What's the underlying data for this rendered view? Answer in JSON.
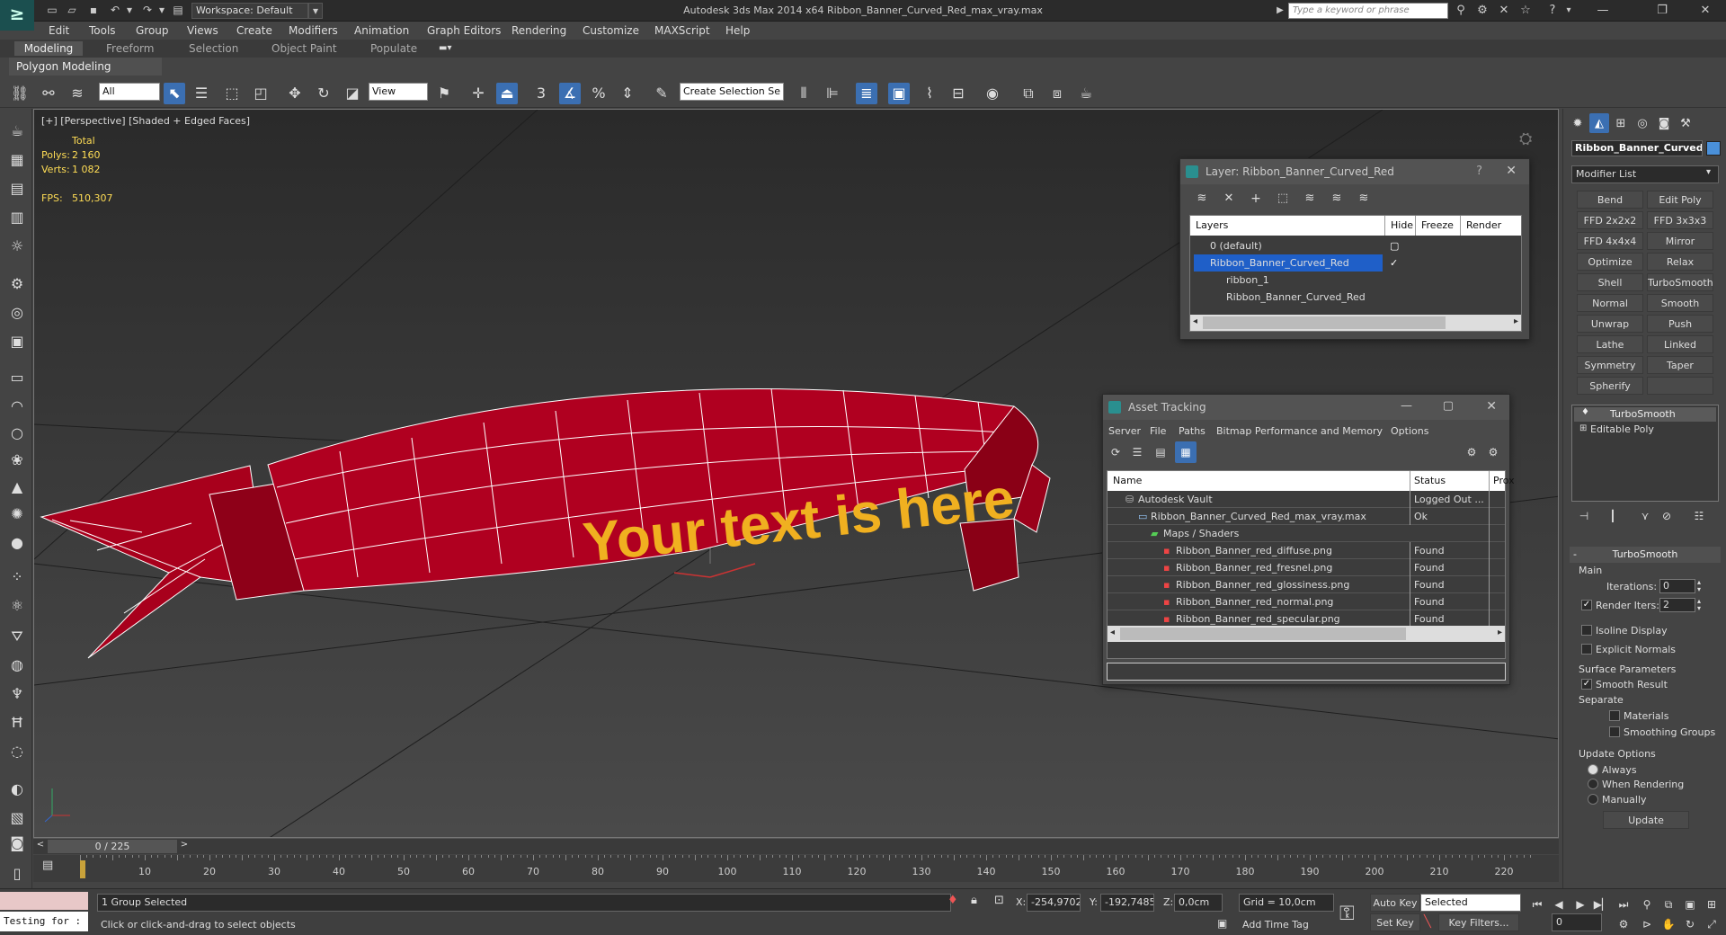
{
  "window": {
    "title": "Autodesk 3ds Max  2014 x64    Ribbon_Banner_Curved_Red_max_vray.max",
    "workspace": "Workspace: Default",
    "search_placeholder": "Type a keyword or phrase"
  },
  "menu": [
    "Edit",
    "Tools",
    "Group",
    "Views",
    "Create",
    "Modifiers",
    "Animation",
    "Graph Editors",
    "Rendering",
    "Customize",
    "MAXScript",
    "Help"
  ],
  "ribbon": {
    "tabs": [
      "Modeling",
      "Freeform",
      "Selection",
      "Object Paint",
      "Populate"
    ],
    "active": "Modeling",
    "panel_label": "Polygon Modeling"
  },
  "toolbar": {
    "selection_filter": "All",
    "ref_coord": "View",
    "named_selection": "Create Selection Se",
    "snap_label": "3",
    "angle_label": "%"
  },
  "viewport": {
    "label": "[+] [Perspective] [Shaded + Edged Faces]",
    "stats": {
      "header": "Total",
      "polys_label": "Polys:",
      "polys": "2 160",
      "verts_label": "Verts:",
      "verts": "1 082",
      "fps_label": "FPS:",
      "fps": "510,307"
    },
    "banner_text": "Your text is here",
    "axis_z": "z"
  },
  "layer_dialog": {
    "title": "Layer: Ribbon_Banner_Curved_Red",
    "columns": [
      "Layers",
      "Hide",
      "Freeze",
      "Render"
    ],
    "rows": [
      {
        "name": "0 (default)",
        "level": 0,
        "selected": false
      },
      {
        "name": "Ribbon_Banner_Curved_Red",
        "level": 0,
        "selected": true,
        "current": true
      },
      {
        "name": "ribbon_1",
        "level": 1,
        "selected": false
      },
      {
        "name": "Ribbon_Banner_Curved_Red",
        "level": 1,
        "selected": false
      }
    ]
  },
  "asset_dialog": {
    "title": "Asset Tracking",
    "menu": [
      "Server",
      "File",
      "Paths",
      "Bitmap Performance and Memory",
      "Options"
    ],
    "columns": [
      "Name",
      "Status",
      "Prox"
    ],
    "rows": [
      {
        "name": "Autodesk Vault",
        "status": "Logged Out ...",
        "level": 1,
        "icon": "vault"
      },
      {
        "name": "Ribbon_Banner_Curved_Red_max_vray.max",
        "status": "Ok",
        "level": 2,
        "icon": "file"
      },
      {
        "name": "Maps / Shaders",
        "status": "",
        "level": 3,
        "icon": "folder"
      },
      {
        "name": "Ribbon_Banner_red_diffuse.png",
        "status": "Found",
        "level": 4,
        "icon": "png"
      },
      {
        "name": "Ribbon_Banner_red_fresnel.png",
        "status": "Found",
        "level": 4,
        "icon": "png"
      },
      {
        "name": "Ribbon_Banner_red_glossiness.png",
        "status": "Found",
        "level": 4,
        "icon": "png"
      },
      {
        "name": "Ribbon_Banner_red_normal.png",
        "status": "Found",
        "level": 4,
        "icon": "png"
      },
      {
        "name": "Ribbon_Banner_red_specular.png",
        "status": "Found",
        "level": 4,
        "icon": "png"
      }
    ]
  },
  "command_panel": {
    "object_name": "Ribbon_Banner_Curved_",
    "object_color": "#4a90d9",
    "modifier_list": "Modifier List",
    "modifier_buttons": [
      "Bend",
      "Edit Poly",
      "FFD 2x2x2",
      "FFD 3x3x3",
      "FFD 4x4x4",
      "Mirror",
      "Optimize",
      "Relax",
      "Shell",
      "TurboSmooth",
      "Normal",
      "Smooth",
      "Unwrap UVW",
      "Push",
      "Lathe",
      "Linked XForm",
      "Symmetry",
      "Taper",
      "Spherify",
      ""
    ],
    "stack": [
      {
        "name": "TurboSmooth",
        "selected": true
      },
      {
        "name": "Editable Poly",
        "selected": false
      }
    ],
    "rollout": {
      "title": "TurboSmooth",
      "main": "Main",
      "iterations_label": "Iterations:",
      "iterations": "0",
      "render_iters_label": "Render Iters:",
      "render_iters": "2",
      "render_iters_checked": true,
      "isoline": "Isoline Display",
      "explicit": "Explicit Normals",
      "surface": "Surface Parameters",
      "smooth_result": "Smooth Result",
      "separate": "Separate",
      "materials": "Materials",
      "smoothing_groups": "Smoothing Groups",
      "update_options": "Update Options",
      "always": "Always",
      "when_rendering": "When Rendering",
      "manually": "Manually",
      "update_btn": "Update"
    }
  },
  "timeline": {
    "frame": "0 / 225",
    "ticks": [
      "10",
      "20",
      "30",
      "40",
      "50",
      "60",
      "70",
      "80",
      "90",
      "100",
      "110",
      "120",
      "130",
      "140",
      "150",
      "160",
      "170",
      "180",
      "190",
      "200",
      "210",
      "220"
    ],
    "tick_values": [
      10,
      20,
      30,
      40,
      50,
      60,
      70,
      80,
      90,
      100,
      110,
      120,
      130,
      140,
      150,
      160,
      170,
      180,
      190,
      200,
      210,
      220
    ],
    "max": 225
  },
  "statusbar": {
    "maxscript": "Testing for :",
    "selected": "1 Group Selected",
    "prompt": "Click or click-and-drag to select objects",
    "x_label": "X:",
    "x": "-254,9702",
    "y_label": "Y:",
    "y": "-192,7485",
    "z_label": "Z:",
    "z": "0,0cm",
    "grid": "Grid = 10,0cm",
    "add_time_tag": "Add Time Tag",
    "auto_key": "Auto Key",
    "set_key": "Set Key",
    "key_mode": "Selected",
    "key_filters": "Key Filters...",
    "frame_field": "0"
  }
}
